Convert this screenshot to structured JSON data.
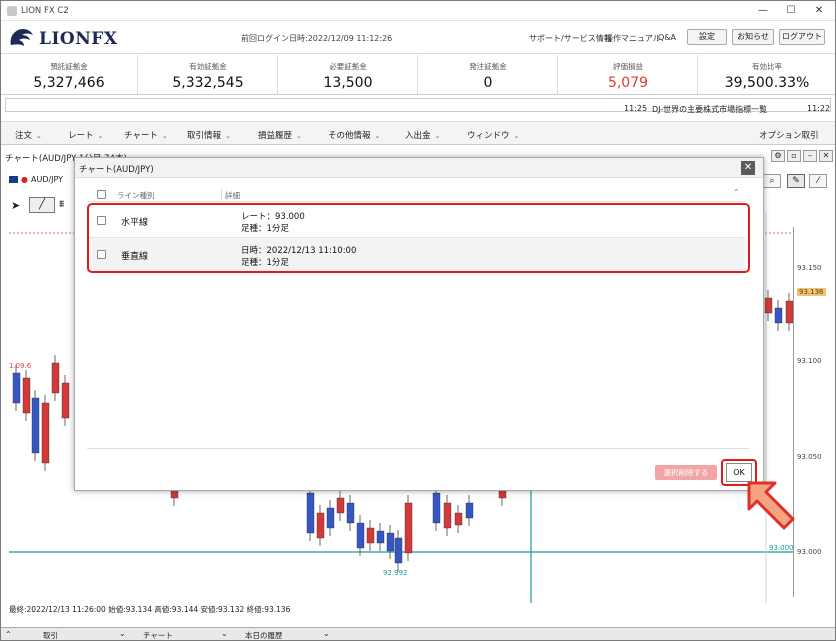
{
  "window": {
    "title": "LION FX C2",
    "minimize": "—",
    "maximize": "☐",
    "close": "✕"
  },
  "header": {
    "logo_text": "LIONFX",
    "last_login": "前回ログイン日時:2022/12/09 11:12:26",
    "links": [
      "サポート/サービス情報",
      "操作マニュアル",
      "Q&A"
    ],
    "buttons": [
      "設定",
      "お知らせ",
      "ログアウト"
    ]
  },
  "summary": [
    {
      "label": "預託証拠金",
      "value": "5,327,466",
      "color": "#111111"
    },
    {
      "label": "有効証拠金",
      "value": "5,332,545",
      "color": "#111111"
    },
    {
      "label": "必要証拠金",
      "value": "13,500",
      "color": "#111111"
    },
    {
      "label": "発注証拠金",
      "value": "0",
      "color": "#111111"
    },
    {
      "label": "評価損益",
      "value": "5,079",
      "color": "#e03a2e"
    },
    {
      "label": "有効比率",
      "value": "39,500.33%",
      "color": "#111111"
    }
  ],
  "news": {
    "time": "11:25",
    "text": "DJ-世界の主要株式市場指標一覧",
    "clock": "11:22"
  },
  "menu": [
    {
      "label": "注文"
    },
    {
      "label": "レート"
    },
    {
      "label": "チャート"
    },
    {
      "label": "取引情報"
    },
    {
      "label": "損益履歴"
    },
    {
      "label": "その他情報"
    },
    {
      "label": "入出金"
    },
    {
      "label": "ウィンドウ"
    }
  ],
  "menu_right": "オプション取引",
  "chart_window": {
    "title": "チャート(AUD/JPY 1分足 74本)",
    "symbol": "AUD/JPY",
    "price_labels": [
      "93.150",
      "93.136",
      "93.100",
      "93.050",
      "93.000"
    ],
    "left_price": "1.09.6",
    "low_label": "92.992",
    "line_label": "93.000",
    "info": "最終:2022/12/13 11:26:00 始値:93.134 高値:93.144 安値:93.132 終値:93.136"
  },
  "bottom_tabs": [
    "取引",
    "チャート",
    "本日の履歴"
  ],
  "dialog": {
    "title": "チャート(AUD/JPY)",
    "col_type": "ライン種別",
    "col_detail": "詳細",
    "rows": [
      {
        "type": "水平線",
        "detail1": "レート：93.000",
        "detail2": "足種：1分足"
      },
      {
        "type": "垂直線",
        "detail1": "日時：2022/12/13 11:10:00",
        "detail2": "足種：1分足"
      }
    ],
    "delete_button": "選択削除する",
    "ok_button": "OK"
  },
  "colors": {
    "highlight": "#e01b1b",
    "arrow_fill": "#f2a481",
    "arrow_stroke": "#e0302b",
    "down_candle": "#3556c4",
    "up_candle": "#d23a3a"
  }
}
